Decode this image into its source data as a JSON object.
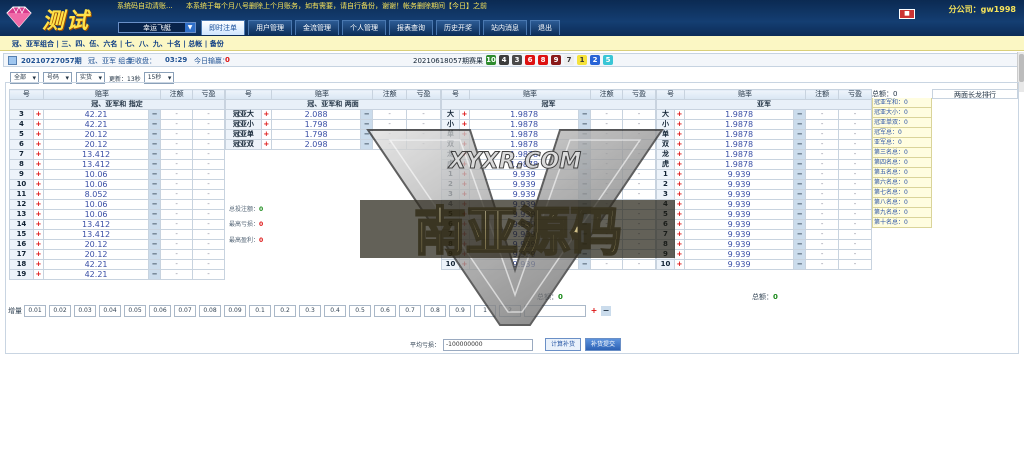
{
  "header": {
    "logo_text": "测试",
    "notice_left": "系统码自动清账...",
    "notice_right": "本系统于每个月八号删除上个月账务，如有需要，请自行备份，谢谢！帐务删除期间【今日】之前",
    "lottery_select": "幸运飞艇",
    "nav_tabs": [
      "即时注单",
      "用户管理",
      "金流管理",
      "个人管理",
      "报表查询",
      "历史开奖",
      "站内消息",
      "退出"
    ],
    "active_tab": 0,
    "user_label": "分公司：gw1998"
  },
  "subnav": {
    "text": "冠、亚军组合 | 三、四、伍、六名 | 七、八、九、十名 | 总帐 | 备份"
  },
  "infobar": {
    "draw_no": "20210727057期",
    "play_label": "冠、亚军 组合",
    "countdown_label": "距收盘：",
    "countdown": "03:29",
    "win_label": "今日输赢：",
    "win_value": "0",
    "prev_draw": "20210618057期赛果",
    "balls": [
      {
        "n": "10",
        "color": "#2e8b2e"
      },
      {
        "n": "4",
        "color": "#3c3c3c"
      },
      {
        "n": "3",
        "color": "#4a4a4a"
      },
      {
        "n": "6",
        "color": "#d11"
      },
      {
        "n": "8",
        "color": "#d11"
      },
      {
        "n": "9",
        "color": "#8a1a1a"
      },
      {
        "n": "7",
        "color": "#eee"
      },
      {
        "n": "1",
        "color": "#f5e23a"
      },
      {
        "n": "2",
        "color": "#2864d6"
      },
      {
        "n": "5",
        "color": "#39c6d6"
      }
    ]
  },
  "controls": {
    "select_all": "全部",
    "select_type": "号码",
    "select_mode": "实货",
    "refresh_label": "更新：13秒",
    "select_interval": "15秒"
  },
  "headers": {
    "num": "号",
    "odds": "赔率",
    "bet": "注额",
    "pl": "亏盈"
  },
  "table1": {
    "group": "冠、亚军和 指定",
    "rows": [
      {
        "num": "3",
        "odds": "42.21",
        "bet": "-",
        "pl": "-"
      },
      {
        "num": "4",
        "odds": "42.21",
        "bet": "-",
        "pl": "-"
      },
      {
        "num": "5",
        "odds": "20.12",
        "bet": "-",
        "pl": "-"
      },
      {
        "num": "6",
        "odds": "20.12",
        "bet": "-",
        "pl": "-"
      },
      {
        "num": "7",
        "odds": "13.412",
        "bet": "-",
        "pl": "-"
      },
      {
        "num": "8",
        "odds": "13.412",
        "bet": "-",
        "pl": "-"
      },
      {
        "num": "9",
        "odds": "10.06",
        "bet": "-",
        "pl": "-"
      },
      {
        "num": "10",
        "odds": "10.06",
        "bet": "-",
        "pl": "-"
      },
      {
        "num": "11",
        "odds": "8.052",
        "bet": "-",
        "pl": "-"
      },
      {
        "num": "12",
        "odds": "10.06",
        "bet": "-",
        "pl": "-"
      },
      {
        "num": "13",
        "odds": "10.06",
        "bet": "-",
        "pl": "-"
      },
      {
        "num": "14",
        "odds": "13.412",
        "bet": "-",
        "pl": "-"
      },
      {
        "num": "15",
        "odds": "13.412",
        "bet": "-",
        "pl": "-"
      },
      {
        "num": "16",
        "odds": "20.12",
        "bet": "-",
        "pl": "-"
      },
      {
        "num": "17",
        "odds": "20.12",
        "bet": "-",
        "pl": "-"
      },
      {
        "num": "18",
        "odds": "42.21",
        "bet": "-",
        "pl": "-"
      },
      {
        "num": "19",
        "odds": "42.21",
        "bet": "-",
        "pl": "-"
      }
    ]
  },
  "table2": {
    "group": "冠、亚军和 两面",
    "rows": [
      {
        "num": "冠亚大",
        "odds": "2.088",
        "bet": "-",
        "pl": "-"
      },
      {
        "num": "冠亚小",
        "odds": "1.798",
        "bet": "-",
        "pl": "-"
      },
      {
        "num": "冠亚单",
        "odds": "1.798",
        "bet": "-",
        "pl": "-"
      },
      {
        "num": "冠亚双",
        "odds": "2.098",
        "bet": "-",
        "pl": "-"
      }
    ],
    "summary": [
      {
        "label": "总投注额：",
        "value": "0"
      },
      {
        "label": "最高亏损：",
        "value": "0"
      },
      {
        "label": "最高盈利：",
        "value": "0"
      }
    ]
  },
  "table3": {
    "group": "冠军",
    "rows": [
      {
        "num": "大",
        "odds": "1.9878",
        "bet": "-",
        "pl": "-"
      },
      {
        "num": "小",
        "odds": "1.9878",
        "bet": "-",
        "pl": "-"
      },
      {
        "num": "单",
        "odds": "1.9878",
        "bet": "-",
        "pl": "-"
      },
      {
        "num": "双",
        "odds": "1.9878",
        "bet": "-",
        "pl": "-"
      },
      {
        "num": "龙",
        "odds": "1.9878",
        "bet": "-",
        "pl": "-"
      },
      {
        "num": "虎",
        "odds": "1.9878",
        "bet": "-",
        "pl": "-"
      },
      {
        "num": "1",
        "odds": "9.939",
        "bet": "-",
        "pl": "-"
      },
      {
        "num": "2",
        "odds": "9.939",
        "bet": "-",
        "pl": "-"
      },
      {
        "num": "3",
        "odds": "9.939",
        "bet": "-",
        "pl": "-"
      },
      {
        "num": "4",
        "odds": "9.939",
        "bet": "-",
        "pl": "-"
      },
      {
        "num": "5",
        "odds": "9.939",
        "bet": "-",
        "pl": "-"
      },
      {
        "num": "6",
        "odds": "9.939",
        "bet": "-",
        "pl": "-"
      },
      {
        "num": "7",
        "odds": "9.939",
        "bet": "-",
        "pl": "-"
      },
      {
        "num": "8",
        "odds": "9.939",
        "bet": "-",
        "pl": "-"
      },
      {
        "num": "9",
        "odds": "9.939",
        "bet": "-",
        "pl": "-"
      },
      {
        "num": "10",
        "odds": "9.939",
        "bet": "-",
        "pl": "-"
      }
    ],
    "total_label": "总额：",
    "total_value": "0"
  },
  "table4": {
    "group": "亚军",
    "rows": [
      {
        "num": "大",
        "odds": "1.9878",
        "bet": "-",
        "pl": "-"
      },
      {
        "num": "小",
        "odds": "1.9878",
        "bet": "-",
        "pl": "-"
      },
      {
        "num": "单",
        "odds": "1.9878",
        "bet": "-",
        "pl": "-"
      },
      {
        "num": "双",
        "odds": "1.9878",
        "bet": "-",
        "pl": "-"
      },
      {
        "num": "龙",
        "odds": "1.9878",
        "bet": "-",
        "pl": "-"
      },
      {
        "num": "虎",
        "odds": "1.9878",
        "bet": "-",
        "pl": "-"
      },
      {
        "num": "1",
        "odds": "9.939",
        "bet": "-",
        "pl": "-"
      },
      {
        "num": "2",
        "odds": "9.939",
        "bet": "-",
        "pl": "-"
      },
      {
        "num": "3",
        "odds": "9.939",
        "bet": "-",
        "pl": "-"
      },
      {
        "num": "4",
        "odds": "9.939",
        "bet": "-",
        "pl": "-"
      },
      {
        "num": "5",
        "odds": "9.939",
        "bet": "-",
        "pl": "-"
      },
      {
        "num": "6",
        "odds": "9.939",
        "bet": "-",
        "pl": "-"
      },
      {
        "num": "7",
        "odds": "9.939",
        "bet": "-",
        "pl": "-"
      },
      {
        "num": "8",
        "odds": "9.939",
        "bet": "-",
        "pl": "-"
      },
      {
        "num": "9",
        "odds": "9.939",
        "bet": "-",
        "pl": "-"
      },
      {
        "num": "10",
        "odds": "9.939",
        "bet": "-",
        "pl": "-"
      }
    ],
    "total_label": "总额：",
    "total_value": "0"
  },
  "ranks": {
    "head": "总额：0",
    "items": [
      "冠亚军和：0",
      "冠亚大小：0",
      "冠亚单双：0",
      "冠军总：0",
      "亚军总：0",
      "第三名总：0",
      "第四名总：0",
      "第五名总：0",
      "第六名总：0",
      "第七名总：0",
      "第八名总：0",
      "第九名总：0",
      "第十名总：0"
    ]
  },
  "long_rank": {
    "head": "两面长龙排行"
  },
  "increments": {
    "label": "增量",
    "values": [
      "0.01",
      "0.02",
      "0.03",
      "0.04",
      "0.05",
      "0.06",
      "0.07",
      "0.08",
      "0.09",
      "0.1",
      "0.2",
      "0.3",
      "0.4",
      "0.5",
      "0.6",
      "0.7",
      "0.8",
      "0.9",
      "1",
      "2"
    ]
  },
  "avg": {
    "label": "平均亏损：",
    "value": "-100000000",
    "btn_calc": "计算补货",
    "btn_submit": "补货提交"
  },
  "watermark": {
    "text_top": "XYXR.COM",
    "text_main": "南亚源码"
  },
  "colors": {
    "nav_bg": "#143e72",
    "accent_red": "#d11",
    "odds_blue": "#3a4fa6"
  }
}
